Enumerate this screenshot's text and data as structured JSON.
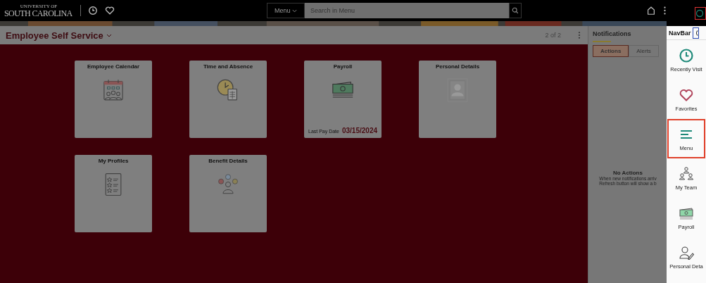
{
  "header": {
    "logo_top": "UNIVERSITY OF",
    "logo_main": "SOUTH CAROLINA",
    "menu_button": "Menu",
    "search": {
      "placeholder": "Search in Menu"
    }
  },
  "title_bar": {
    "title": "Employee Self Service",
    "pager": "2 of 2"
  },
  "tiles": [
    {
      "title": "Employee Calendar",
      "kind": "calendar"
    },
    {
      "title": "Time and Absence",
      "kind": "clock"
    },
    {
      "title": "Payroll",
      "kind": "money",
      "footer_label": "Last Pay Date",
      "footer_value": "03/15/2024"
    },
    {
      "title": "Personal Details"
    },
    {
      "title": "My Profiles",
      "kind": "profile"
    },
    {
      "title": "Benefit Details",
      "kind": "benefit"
    }
  ],
  "notifications": {
    "title": "Notifications",
    "tabs": [
      {
        "label": "Actions",
        "selected": true
      },
      {
        "label": "Alerts",
        "selected": false
      }
    ],
    "empty_title": "No Actions",
    "empty_lines": [
      "When new notifications arriv",
      "Refresh button will show a b"
    ]
  },
  "navbar": {
    "title": "NavBar",
    "items": [
      {
        "label": "Recently Visit",
        "kind": "clock",
        "selected": false
      },
      {
        "label": "Favorites",
        "kind": "heart",
        "selected": false
      },
      {
        "label": "Menu",
        "kind": "menu",
        "selected": true
      },
      {
        "label": "My Team",
        "kind": "team",
        "selected": false
      },
      {
        "label": "Payroll",
        "kind": "money",
        "selected": false
      },
      {
        "label": "Personal Deta",
        "kind": "person",
        "selected": false
      }
    ]
  }
}
